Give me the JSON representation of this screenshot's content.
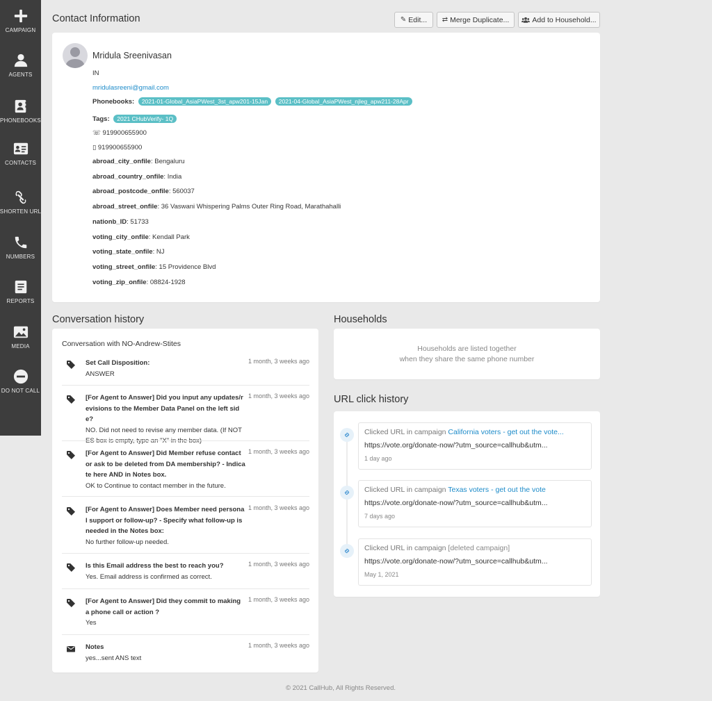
{
  "sidebar": {
    "items": [
      {
        "label": "CAMPAIGN",
        "icon": "plus-icon"
      },
      {
        "label": "AGENTS",
        "icon": "user-icon"
      },
      {
        "label": "PHONEBOOKS",
        "icon": "phonebook-icon"
      },
      {
        "label": "CONTACTS",
        "icon": "contact-card-icon"
      },
      {
        "label": "SHORTEN URL",
        "icon": "link-icon"
      },
      {
        "label": "NUMBERS",
        "icon": "phone-icon"
      },
      {
        "label": "REPORTS",
        "icon": "report-icon"
      },
      {
        "label": "MEDIA",
        "icon": "image-icon"
      },
      {
        "label": "DO NOT CALL",
        "icon": "minus-circle-icon"
      }
    ]
  },
  "header": {
    "title": "Contact Information",
    "edit_label": "Edit...",
    "merge_label": "Merge Duplicate...",
    "household_label": "Add to Household..."
  },
  "contact": {
    "name": "Mridula Sreenivasan",
    "country": "IN",
    "email": "mridulasreeni@gmail.com",
    "phonebooks_label": "Phonebooks:",
    "phonebooks": [
      "2021-01-Global_AsiaPWest_3st_apw201-15Jan",
      "2021-04-Global_AsiaPWest_njleg_apw211-28Apr"
    ],
    "tags_label": "Tags:",
    "tags": [
      "2021 CHubVerify- 1Q"
    ],
    "phone": "919900655900",
    "mobile": "919900655900",
    "fields": [
      {
        "key": "abroad_city_onfile",
        "value": ": Bengaluru"
      },
      {
        "key": "abroad_country_onfile",
        "value": ": India"
      },
      {
        "key": "abroad_postcode_onfile",
        "value": ": 560037"
      },
      {
        "key": "abroad_street_onfile",
        "value": ": 36 Vaswani Whispering Palms Outer Ring Road, Marathahalli"
      },
      {
        "key": "nationb_ID",
        "value": ": 51733"
      },
      {
        "key": "voting_city_onfile",
        "value": ": Kendall Park"
      },
      {
        "key": "voting_state_onfile",
        "value": ": NJ"
      },
      {
        "key": "voting_street_onfile",
        "value": ": 15 Providence Blvd"
      },
      {
        "key": "voting_zip_onfile",
        "value": ": 08824-1928"
      }
    ]
  },
  "conversation": {
    "title": "Conversation history",
    "with": "Conversation with NO-Andrew-Stites",
    "items": [
      {
        "question": "Set Call Disposition:",
        "answer": "ANSWER",
        "time": "1 month, 3 weeks ago",
        "icon": "tag-icon"
      },
      {
        "question": "[For Agent to Answer] Did you input any updates/revisions to the Member Data Panel on the left side?",
        "answer": "NO. Did not need to revise any member data. (If NOTES box is empty, type an \"X\" in the box)",
        "time": "1 month, 3 weeks ago",
        "icon": "tag-icon"
      },
      {
        "question": "[For Agent to Answer] Did Member refuse contact or ask to be deleted from DA membership? - Indicate here AND in Notes box.",
        "answer": "OK to Continue to contact member in the future.",
        "time": "1 month, 3 weeks ago",
        "icon": "tag-icon"
      },
      {
        "question": "[For Agent to Answer] Does Member need personal support or follow-up? - Specify what follow-up is needed in the Notes box:",
        "answer": "No further follow-up needed.",
        "time": "1 month, 3 weeks ago",
        "icon": "tag-icon"
      },
      {
        "question": "Is this Email address the best to reach you?",
        "answer": "Yes. Email address is confirmed as correct.",
        "time": "1 month, 3 weeks ago",
        "icon": "tag-icon"
      },
      {
        "question": "[For Agent to Answer] Did they commit to making a phone call or action ?",
        "answer": "Yes",
        "time": "1 month, 3 weeks ago",
        "icon": "tag-icon"
      },
      {
        "question": "Notes",
        "answer": "yes...sent ANS text",
        "time": "1 month, 3 weeks ago",
        "icon": "envelope-icon"
      }
    ]
  },
  "households": {
    "title": "Households",
    "empty_line1": "Households are listed together",
    "empty_line2": "when they share the same phone number"
  },
  "url_history": {
    "title": "URL click history",
    "items": [
      {
        "prefix": "Clicked URL in campaign ",
        "campaign": "California voters - get out the vote...",
        "url": "https://vote.org/donate-now/?utm_source=callhub&utm...",
        "time": "1 day ago"
      },
      {
        "prefix": "Clicked URL in campaign ",
        "campaign": "Texas voters - get out the vote",
        "url": "https://vote.org/donate-now/?utm_source=callhub&utm...",
        "time": "7 days ago"
      },
      {
        "prefix": "Clicked URL in campaign ",
        "campaign": "[deleted campaign]",
        "url": "https://vote.org/donate-now/?utm_source=callhub&utm...",
        "time": "May 1, 2021"
      }
    ]
  },
  "footer": "© 2021 CallHub, All Rights Reserved.",
  "colors": {
    "accent": "#1d8bc9",
    "tag": "#5bbfc6",
    "sidebar": "#3d3d3d"
  }
}
